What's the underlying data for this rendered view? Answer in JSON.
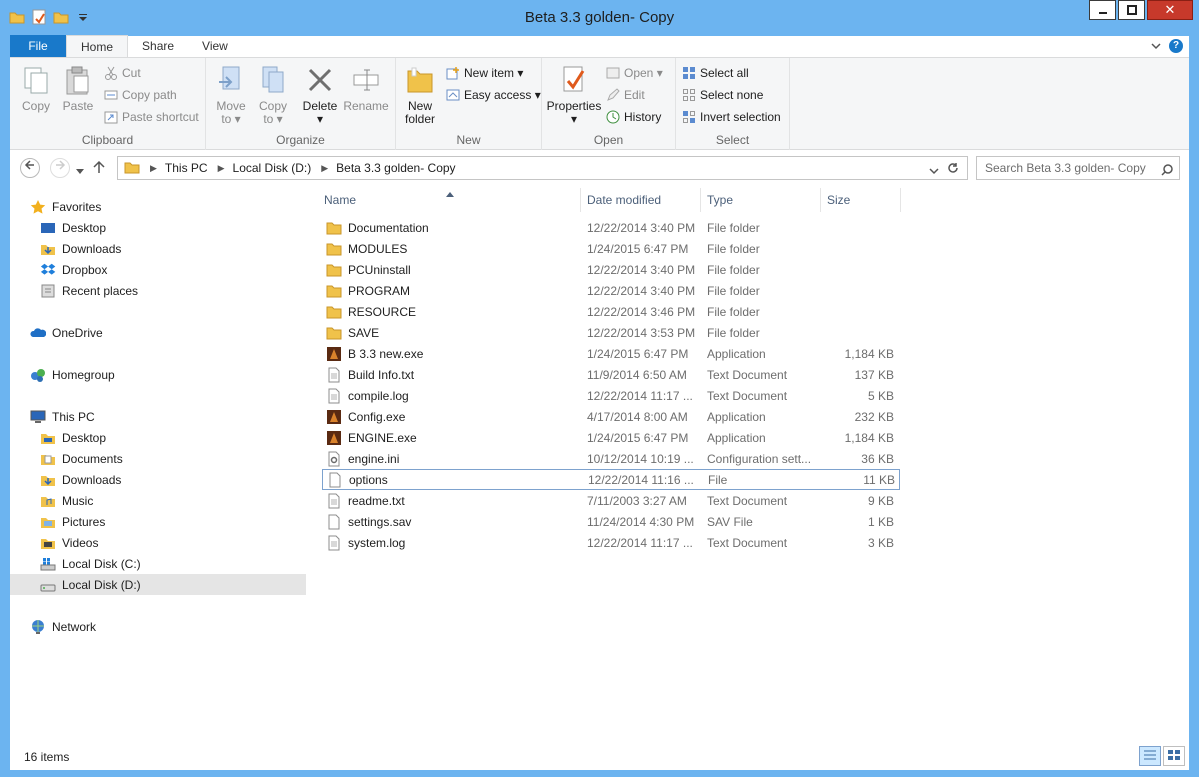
{
  "window": {
    "title": "Beta 3.3 golden- Copy",
    "controls": {
      "minimize": "–",
      "maximize": "□",
      "close": "✕"
    }
  },
  "ribbon": {
    "tabs": [
      "File",
      "Home",
      "Share",
      "View"
    ],
    "active_tab": "Home",
    "groups": {
      "clipboard": {
        "label": "Clipboard",
        "copy": "Copy",
        "paste": "Paste",
        "cut": "Cut",
        "copy_path": "Copy path",
        "paste_shortcut": "Paste shortcut"
      },
      "organize": {
        "label": "Organize",
        "move_to": "Move",
        "move_to_2": "to ▾",
        "copy_to": "Copy",
        "copy_to_2": "to ▾",
        "delete": "Delete",
        "delete_arrow": "▾",
        "rename": "Rename"
      },
      "new": {
        "label": "New",
        "new_folder": "New",
        "new_folder_2": "folder",
        "new_item": "New item ▾",
        "easy_access": "Easy access ▾"
      },
      "open": {
        "label": "Open",
        "properties": "Properties",
        "properties_arrow": "▾",
        "open": "Open ▾",
        "edit": "Edit",
        "history": "History"
      },
      "select": {
        "label": "Select",
        "select_all": "Select all",
        "select_none": "Select none",
        "invert": "Invert selection"
      }
    }
  },
  "address": {
    "crumbs": [
      "This PC",
      "Local Disk (D:)",
      "Beta 3.3 golden- Copy"
    ],
    "search_placeholder": "Search Beta 3.3 golden- Copy"
  },
  "nav": {
    "favorites": "Favorites",
    "fav_items": [
      "Desktop",
      "Downloads",
      "Dropbox",
      "Recent places"
    ],
    "onedrive": "OneDrive",
    "homegroup": "Homegroup",
    "thispc": "This PC",
    "pc_items": [
      "Desktop",
      "Documents",
      "Downloads",
      "Music",
      "Pictures",
      "Videos",
      "Local Disk (C:)",
      "Local Disk (D:)"
    ],
    "network": "Network"
  },
  "columns": {
    "name": "Name",
    "date": "Date modified",
    "type": "Type",
    "size": "Size"
  },
  "files": [
    {
      "name": "Documentation",
      "date": "12/22/2014 3:40 PM",
      "type": "File folder",
      "size": "",
      "icon": "folder-icon"
    },
    {
      "name": "MODULES",
      "date": "1/24/2015 6:47 PM",
      "type": "File folder",
      "size": "",
      "icon": "folder-icon"
    },
    {
      "name": "PCUninstall",
      "date": "12/22/2014 3:40 PM",
      "type": "File folder",
      "size": "",
      "icon": "folder-icon"
    },
    {
      "name": "PROGRAM",
      "date": "12/22/2014 3:40 PM",
      "type": "File folder",
      "size": "",
      "icon": "folder-icon"
    },
    {
      "name": "RESOURCE",
      "date": "12/22/2014 3:46 PM",
      "type": "File folder",
      "size": "",
      "icon": "folder-icon"
    },
    {
      "name": "SAVE",
      "date": "12/22/2014 3:53 PM",
      "type": "File folder",
      "size": "",
      "icon": "folder-icon"
    },
    {
      "name": "B 3.3 new.exe",
      "date": "1/24/2015 6:47 PM",
      "type": "Application",
      "size": "1,184 KB",
      "icon": "app-icon"
    },
    {
      "name": "Build Info.txt",
      "date": "11/9/2014 6:50 AM",
      "type": "Text Document",
      "size": "137 KB",
      "icon": "text-file-icon"
    },
    {
      "name": "compile.log",
      "date": "12/22/2014 11:17 ...",
      "type": "Text Document",
      "size": "5 KB",
      "icon": "text-file-icon"
    },
    {
      "name": "Config.exe",
      "date": "4/17/2014 8:00 AM",
      "type": "Application",
      "size": "232 KB",
      "icon": "app-icon"
    },
    {
      "name": "ENGINE.exe",
      "date": "1/24/2015 6:47 PM",
      "type": "Application",
      "size": "1,184 KB",
      "icon": "app-icon"
    },
    {
      "name": "engine.ini",
      "date": "10/12/2014 10:19 ...",
      "type": "Configuration sett...",
      "size": "36 KB",
      "icon": "config-file-icon"
    },
    {
      "name": "options",
      "date": "12/22/2014 11:16 ...",
      "type": "File",
      "size": "11 KB",
      "icon": "blank-file-icon"
    },
    {
      "name": "readme.txt",
      "date": "7/11/2003 3:27 AM",
      "type": "Text Document",
      "size": "9 KB",
      "icon": "text-file-icon"
    },
    {
      "name": "settings.sav",
      "date": "11/24/2014 4:30 PM",
      "type": "SAV File",
      "size": "1 KB",
      "icon": "blank-file-icon"
    },
    {
      "name": "system.log",
      "date": "12/22/2014 11:17 ...",
      "type": "Text Document",
      "size": "3 KB",
      "icon": "text-file-icon"
    }
  ],
  "status": {
    "count": "16 items"
  },
  "colors": {
    "frame": "#6cb4f0",
    "file_tab": "#1979ca",
    "close": "#c7392b",
    "folder": "#f0c24a",
    "selection": "#e5e5e5",
    "header_text": "#4c607a"
  }
}
